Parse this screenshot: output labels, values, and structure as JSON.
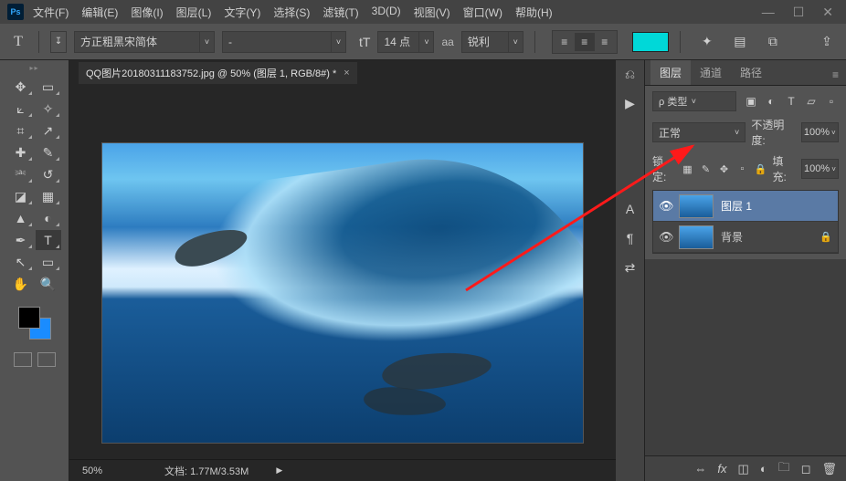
{
  "titlebar": {
    "logo": "Ps",
    "menus": [
      "文件(F)",
      "编辑(E)",
      "图像(I)",
      "图层(L)",
      "文字(Y)",
      "选择(S)",
      "滤镜(T)",
      "3D(D)",
      "视图(V)",
      "窗口(W)",
      "帮助(H)"
    ]
  },
  "options": {
    "tool_glyph": "T",
    "font_family": "方正粗黑宋简体",
    "font_style": "-",
    "size_label": "tT",
    "font_size": "14 点",
    "aa_label": "aa",
    "aa_mode": "锐利",
    "accent_color": "#00d8d8"
  },
  "document": {
    "tab_title": "QQ图片20180311183752.jpg @ 50% (图层 1, RGB/8#) *",
    "zoom": "50%",
    "doc_info": "文档: 1.77M/3.53M"
  },
  "panels": {
    "tabs": [
      "图层",
      "通道",
      "路径"
    ],
    "kind_label": "ρ 类型",
    "blend_mode": "正常",
    "opacity_label": "不透明度:",
    "opacity_value": "100%",
    "lock_label": "锁定:",
    "fill_label": "填充:",
    "fill_value": "100%",
    "layers": [
      {
        "name": "图层 1",
        "locked": false,
        "visible": true,
        "selected": true
      },
      {
        "name": "背景",
        "locked": true,
        "visible": true,
        "selected": false
      }
    ]
  },
  "tools_left": [
    "move",
    "marquee",
    "lasso",
    "magic-wand",
    "crop",
    "eyedropper",
    "spot-heal",
    "brush",
    "clone",
    "history-brush",
    "eraser",
    "gradient",
    "blur",
    "dodge",
    "pen",
    "type",
    "path-select",
    "rectangle",
    "hand",
    "zoom"
  ]
}
